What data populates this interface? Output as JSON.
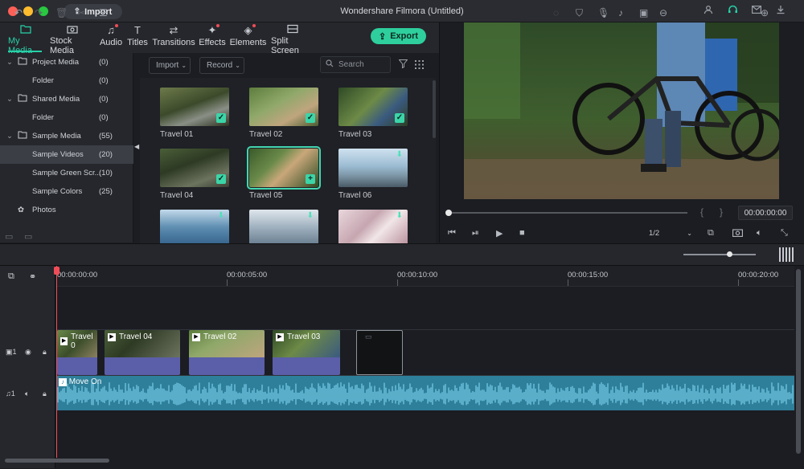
{
  "titlebar": {
    "title": "Wondershare Filmora (Untitled)",
    "import_label": "Import"
  },
  "tabs": [
    {
      "label": "My Media",
      "icon": "folder-icon"
    },
    {
      "label": "Stock Media",
      "icon": "camera-icon"
    },
    {
      "label": "Audio",
      "icon": "music-icon"
    },
    {
      "label": "Titles",
      "icon": "text-icon"
    },
    {
      "label": "Transitions",
      "icon": "transitions-icon"
    },
    {
      "label": "Effects",
      "icon": "effects-icon"
    },
    {
      "label": "Elements",
      "icon": "elements-icon"
    },
    {
      "label": "Split Screen",
      "icon": "split-screen-icon"
    }
  ],
  "export_label": "Export",
  "sidebar": {
    "items": [
      {
        "label": "Project Media",
        "count": "(0)"
      },
      {
        "label": "Folder",
        "count": "(0)"
      },
      {
        "label": "Shared Media",
        "count": "(0)"
      },
      {
        "label": "Folder",
        "count": "(0)"
      },
      {
        "label": "Sample Media",
        "count": "(55)"
      },
      {
        "label": "Sample Videos",
        "count": "(20)"
      },
      {
        "label": "Sample Green Scr...",
        "count": "(10)"
      },
      {
        "label": "Sample Colors",
        "count": "(25)"
      },
      {
        "label": "Photos",
        "count": ""
      }
    ]
  },
  "media_toolbar": {
    "import": "Import",
    "record": "Record",
    "search_placeholder": "Search"
  },
  "media": [
    {
      "label": "Travel 01",
      "state": "check"
    },
    {
      "label": "Travel 02",
      "state": "check"
    },
    {
      "label": "Travel 03",
      "state": "check"
    },
    {
      "label": "Travel 04",
      "state": "check"
    },
    {
      "label": "Travel 05",
      "state": "add"
    },
    {
      "label": "Travel 06",
      "state": "download"
    },
    {
      "label": "",
      "state": "download"
    },
    {
      "label": "",
      "state": "download"
    },
    {
      "label": "",
      "state": "download"
    }
  ],
  "preview": {
    "timecode": "00:00:00:00",
    "quality": "1/2",
    "progress": 0
  },
  "ruler": [
    "00:00:00:00",
    "00:00:05:00",
    "00:00:10:00",
    "00:00:15:00",
    "00:00:20:00"
  ],
  "clips": [
    "Travel 0",
    "Travel 04",
    "Travel 02",
    "Travel 03"
  ],
  "audio_clip": "Move On",
  "track_labels": {
    "video": "1",
    "audio": "1"
  },
  "zoom_level": 0.62
}
